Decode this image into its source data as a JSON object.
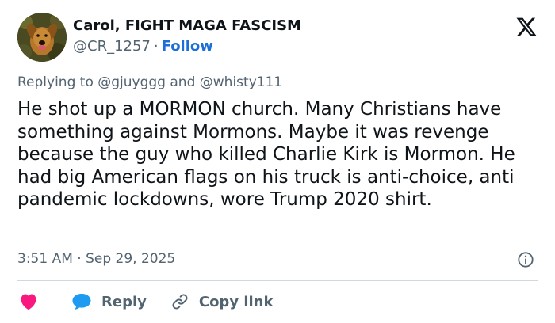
{
  "author": {
    "display_name": "Carol, FIGHT MAGA FASCISM",
    "handle": "@CR_1257",
    "separator": "·",
    "follow_label": "Follow"
  },
  "reply_context": {
    "prefix": "Replying to",
    "mention_1": "@gjuyggg",
    "joiner": "and",
    "mention_2": "@whisty111"
  },
  "tweet": {
    "text": "He shot up a MORMON church. Many Christians have something against Mormons. Maybe it was revenge because the guy who killed Charlie Kirk is Mormon. He had big American flags on his truck is anti-choice, anti pandemic lockdowns, wore Trump 2020 shirt.",
    "timestamp": "3:51 AM · Sep 29, 2025"
  },
  "actions": {
    "reply_label": "Reply",
    "copy_link_label": "Copy link"
  },
  "icons": {
    "brand": "x-logo-icon",
    "info": "info-icon",
    "like": "heart-icon",
    "reply": "speech-bubble-icon",
    "copy_link": "link-icon"
  },
  "colors": {
    "text": "#0f1419",
    "secondary": "#536471",
    "link_blue": "#1d6fd8",
    "heart_pink": "#f91880",
    "reply_blue": "#1d9bf0",
    "divider": "#cfd9de"
  }
}
